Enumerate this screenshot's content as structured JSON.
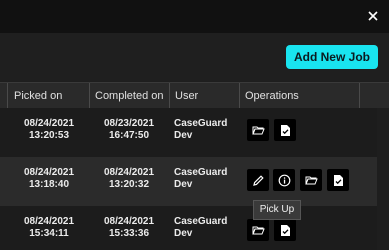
{
  "window": {
    "close_glyph": "×"
  },
  "toolbar": {
    "add_job_label": "Add New Job"
  },
  "table": {
    "headers": {
      "picked_on": "Picked on",
      "completed_on": "Completed on",
      "user": "User",
      "operations": "Operations"
    },
    "rows": [
      {
        "picked_date": "08/24/2021",
        "picked_time": "13:20:53",
        "completed_date": "08/23/2021",
        "completed_time": "16:47:50",
        "user_line1": "CaseGuard",
        "user_line2": "Dev",
        "operations": [
          "folder-open-icon",
          "document-check-icon"
        ]
      },
      {
        "picked_date": "08/24/2021",
        "picked_time": "13:18:40",
        "completed_date": "08/24/2021",
        "completed_time": "13:20:32",
        "user_line1": "CaseGuard",
        "user_line2": "Dev",
        "operations": [
          "pencil-icon",
          "info-icon",
          "folder-open-icon",
          "document-check-icon"
        ]
      },
      {
        "picked_date": "08/24/2021",
        "picked_time": "15:34:11",
        "completed_date": "08/24/2021",
        "completed_time": "15:33:36",
        "user_line1": "CaseGuard",
        "user_line2": "Dev",
        "operations": [
          "folder-open-icon",
          "document-check-icon"
        ]
      }
    ]
  },
  "tooltip": {
    "text": "Pick Up"
  },
  "colors": {
    "accent": "#19e4ef",
    "background": "#1e1e1e",
    "row_alt": "#2b2b2b"
  }
}
